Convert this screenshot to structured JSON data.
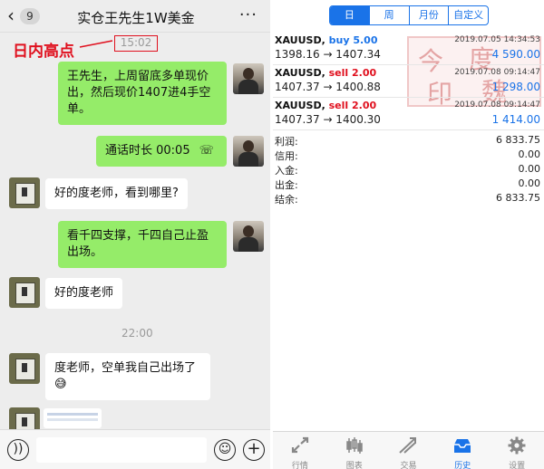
{
  "chat": {
    "badge": "9",
    "title": "实仓王先生1W美金",
    "annotation": "日内高点",
    "timestamp1": "15:02",
    "timestamp2": "22:00",
    "messages": [
      {
        "from": "me",
        "text": "王先生，上周留底多单现价出，然后现价1407进4手空单。"
      },
      {
        "from": "me",
        "text": "通话时长 00:05"
      },
      {
        "from": "them",
        "text": "好的度老师，看到哪里?"
      },
      {
        "from": "me",
        "text": "看千四支撑，千四自己止盈出场。"
      },
      {
        "from": "them",
        "text": "好的度老师"
      },
      {
        "from": "them",
        "text": "度老师，空单我自己出场了😅"
      }
    ]
  },
  "history": {
    "tabs": [
      {
        "label": "日",
        "active": true
      },
      {
        "label": "周",
        "active": false
      },
      {
        "label": "月份",
        "active": false
      },
      {
        "label": "自定义",
        "active": false
      }
    ],
    "trades": [
      {
        "symbol": "XAUUSD,",
        "side": "buy",
        "lots": "5.00",
        "date": "2019.07.05 14:34:53",
        "prices": "1398.16 → 1407.34",
        "profit": "4 590.00"
      },
      {
        "symbol": "XAUUSD,",
        "side": "sell",
        "lots": "2.00",
        "date": "2019.07.08 09:14:47",
        "prices": "1407.37 → 1400.88",
        "profit": "1 298.00"
      },
      {
        "symbol": "XAUUSD,",
        "side": "sell",
        "lots": "2.00",
        "date": "2019.07.08 09:14:47",
        "prices": "1407.37 → 1400.30",
        "profit": "1 414.00"
      }
    ],
    "summary": [
      {
        "label": "利润:",
        "value": "6 833.75"
      },
      {
        "label": "信用:",
        "value": "0.00"
      },
      {
        "label": "入金:",
        "value": "0.00"
      },
      {
        "label": "出金:",
        "value": "0.00"
      },
      {
        "label": "结余:",
        "value": "6 833.75"
      }
    ],
    "watermark": [
      "今",
      "度",
      "印",
      "魏"
    ],
    "nav": [
      {
        "label": "行情",
        "icon": "quotes-icon",
        "active": false
      },
      {
        "label": "图表",
        "icon": "chart-icon",
        "active": false
      },
      {
        "label": "交易",
        "icon": "trade-icon",
        "active": false
      },
      {
        "label": "历史",
        "icon": "history-icon",
        "active": true
      },
      {
        "label": "设置",
        "icon": "settings-icon",
        "active": false
      }
    ]
  },
  "colors": {
    "accent": "#1a73e8",
    "sell": "#e0101e",
    "bubble_me": "#95ec69"
  }
}
